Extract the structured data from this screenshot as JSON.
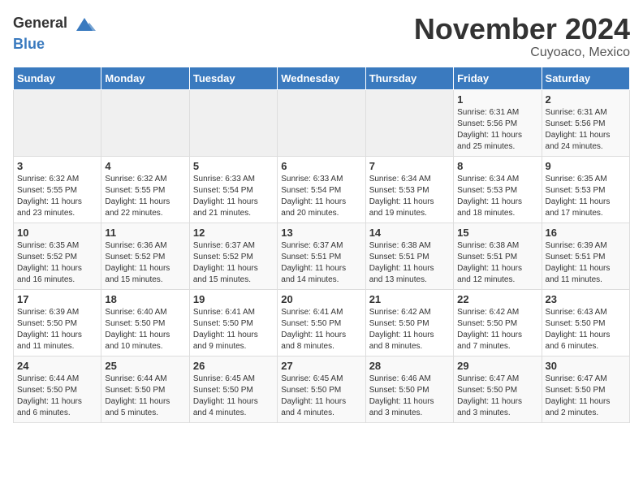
{
  "header": {
    "logo_general": "General",
    "logo_blue": "Blue",
    "month_title": "November 2024",
    "subtitle": "Cuyoaco, Mexico"
  },
  "days_of_week": [
    "Sunday",
    "Monday",
    "Tuesday",
    "Wednesday",
    "Thursday",
    "Friday",
    "Saturday"
  ],
  "weeks": [
    [
      {
        "day": "",
        "info": "",
        "empty": true
      },
      {
        "day": "",
        "info": "",
        "empty": true
      },
      {
        "day": "",
        "info": "",
        "empty": true
      },
      {
        "day": "",
        "info": "",
        "empty": true
      },
      {
        "day": "",
        "info": "",
        "empty": true
      },
      {
        "day": "1",
        "info": "Sunrise: 6:31 AM\nSunset: 5:56 PM\nDaylight: 11 hours\nand 25 minutes."
      },
      {
        "day": "2",
        "info": "Sunrise: 6:31 AM\nSunset: 5:56 PM\nDaylight: 11 hours\nand 24 minutes."
      }
    ],
    [
      {
        "day": "3",
        "info": "Sunrise: 6:32 AM\nSunset: 5:55 PM\nDaylight: 11 hours\nand 23 minutes."
      },
      {
        "day": "4",
        "info": "Sunrise: 6:32 AM\nSunset: 5:55 PM\nDaylight: 11 hours\nand 22 minutes."
      },
      {
        "day": "5",
        "info": "Sunrise: 6:33 AM\nSunset: 5:54 PM\nDaylight: 11 hours\nand 21 minutes."
      },
      {
        "day": "6",
        "info": "Sunrise: 6:33 AM\nSunset: 5:54 PM\nDaylight: 11 hours\nand 20 minutes."
      },
      {
        "day": "7",
        "info": "Sunrise: 6:34 AM\nSunset: 5:53 PM\nDaylight: 11 hours\nand 19 minutes."
      },
      {
        "day": "8",
        "info": "Sunrise: 6:34 AM\nSunset: 5:53 PM\nDaylight: 11 hours\nand 18 minutes."
      },
      {
        "day": "9",
        "info": "Sunrise: 6:35 AM\nSunset: 5:53 PM\nDaylight: 11 hours\nand 17 minutes."
      }
    ],
    [
      {
        "day": "10",
        "info": "Sunrise: 6:35 AM\nSunset: 5:52 PM\nDaylight: 11 hours\nand 16 minutes."
      },
      {
        "day": "11",
        "info": "Sunrise: 6:36 AM\nSunset: 5:52 PM\nDaylight: 11 hours\nand 15 minutes."
      },
      {
        "day": "12",
        "info": "Sunrise: 6:37 AM\nSunset: 5:52 PM\nDaylight: 11 hours\nand 15 minutes."
      },
      {
        "day": "13",
        "info": "Sunrise: 6:37 AM\nSunset: 5:51 PM\nDaylight: 11 hours\nand 14 minutes."
      },
      {
        "day": "14",
        "info": "Sunrise: 6:38 AM\nSunset: 5:51 PM\nDaylight: 11 hours\nand 13 minutes."
      },
      {
        "day": "15",
        "info": "Sunrise: 6:38 AM\nSunset: 5:51 PM\nDaylight: 11 hours\nand 12 minutes."
      },
      {
        "day": "16",
        "info": "Sunrise: 6:39 AM\nSunset: 5:51 PM\nDaylight: 11 hours\nand 11 minutes."
      }
    ],
    [
      {
        "day": "17",
        "info": "Sunrise: 6:39 AM\nSunset: 5:50 PM\nDaylight: 11 hours\nand 11 minutes."
      },
      {
        "day": "18",
        "info": "Sunrise: 6:40 AM\nSunset: 5:50 PM\nDaylight: 11 hours\nand 10 minutes."
      },
      {
        "day": "19",
        "info": "Sunrise: 6:41 AM\nSunset: 5:50 PM\nDaylight: 11 hours\nand 9 minutes."
      },
      {
        "day": "20",
        "info": "Sunrise: 6:41 AM\nSunset: 5:50 PM\nDaylight: 11 hours\nand 8 minutes."
      },
      {
        "day": "21",
        "info": "Sunrise: 6:42 AM\nSunset: 5:50 PM\nDaylight: 11 hours\nand 8 minutes."
      },
      {
        "day": "22",
        "info": "Sunrise: 6:42 AM\nSunset: 5:50 PM\nDaylight: 11 hours\nand 7 minutes."
      },
      {
        "day": "23",
        "info": "Sunrise: 6:43 AM\nSunset: 5:50 PM\nDaylight: 11 hours\nand 6 minutes."
      }
    ],
    [
      {
        "day": "24",
        "info": "Sunrise: 6:44 AM\nSunset: 5:50 PM\nDaylight: 11 hours\nand 6 minutes."
      },
      {
        "day": "25",
        "info": "Sunrise: 6:44 AM\nSunset: 5:50 PM\nDaylight: 11 hours\nand 5 minutes."
      },
      {
        "day": "26",
        "info": "Sunrise: 6:45 AM\nSunset: 5:50 PM\nDaylight: 11 hours\nand 4 minutes."
      },
      {
        "day": "27",
        "info": "Sunrise: 6:45 AM\nSunset: 5:50 PM\nDaylight: 11 hours\nand 4 minutes."
      },
      {
        "day": "28",
        "info": "Sunrise: 6:46 AM\nSunset: 5:50 PM\nDaylight: 11 hours\nand 3 minutes."
      },
      {
        "day": "29",
        "info": "Sunrise: 6:47 AM\nSunset: 5:50 PM\nDaylight: 11 hours\nand 3 minutes."
      },
      {
        "day": "30",
        "info": "Sunrise: 6:47 AM\nSunset: 5:50 PM\nDaylight: 11 hours\nand 2 minutes."
      }
    ]
  ]
}
